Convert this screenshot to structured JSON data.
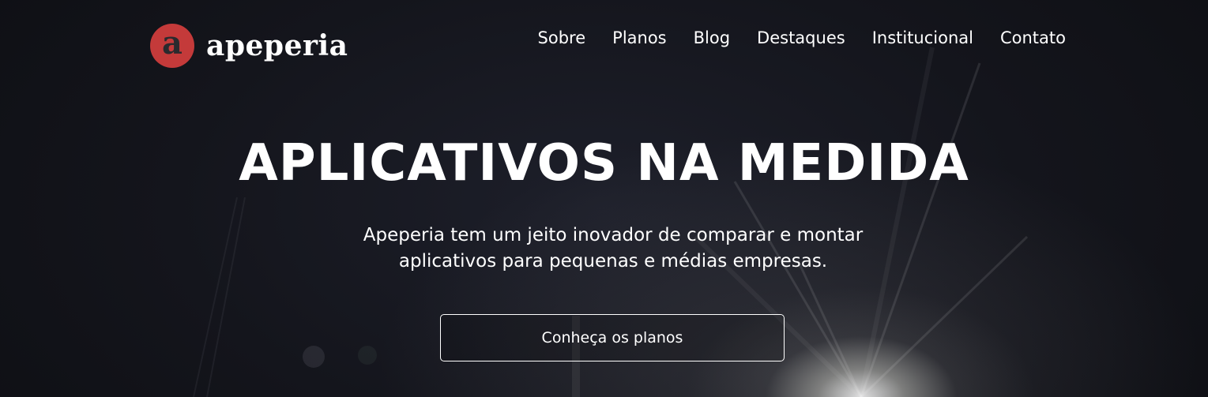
{
  "brand": {
    "logo_letter": "a",
    "name": "apeperia",
    "mark_color": "#c43a3a"
  },
  "nav": {
    "items": [
      {
        "label": "Sobre"
      },
      {
        "label": "Planos"
      },
      {
        "label": "Blog"
      },
      {
        "label": "Destaques"
      },
      {
        "label": "Institucional"
      },
      {
        "label": "Contato"
      }
    ]
  },
  "hero": {
    "headline": "APLICATIVOS NA MEDIDA",
    "subtitle_line1": "Apeperia tem um jeito inovador de comparar e montar",
    "subtitle_line2": "aplicativos para pequenas e médias empresas.",
    "cta_label": "Conheça os planos"
  },
  "colors": {
    "background": "#15161c",
    "text": "#ffffff"
  }
}
